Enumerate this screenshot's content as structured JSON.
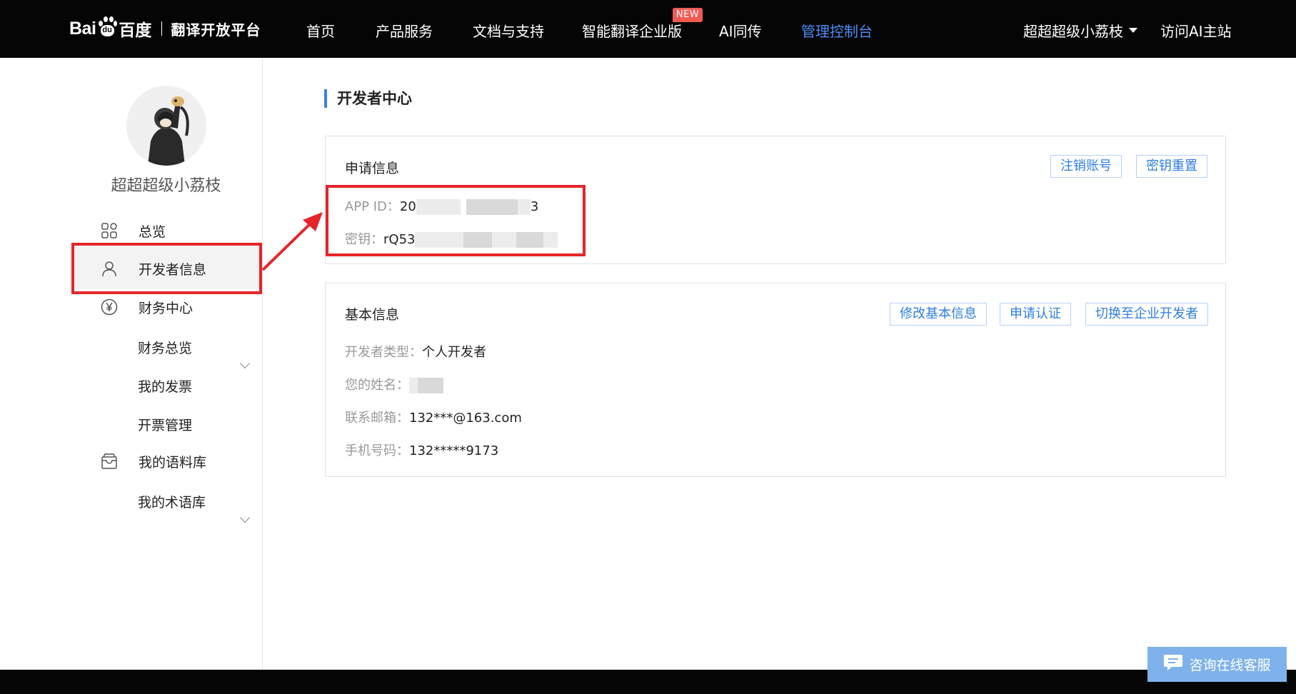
{
  "brand": {
    "logo_latin": "Bai",
    "logo_paw": "du",
    "logo_cn": "百度",
    "platform": "翻译开放平台"
  },
  "nav": {
    "items": [
      {
        "label": "首页"
      },
      {
        "label": "产品服务"
      },
      {
        "label": "文档与支持"
      },
      {
        "label": "智能翻译企业版"
      },
      {
        "label": "AI同传"
      },
      {
        "label": "管理控制台"
      }
    ],
    "new_badge": "NEW",
    "user": "超超超级小荔枝",
    "visit": "访问AI主站",
    "active_color": "#4b8df8"
  },
  "sidebar": {
    "user_name": "超超超级小荔枝",
    "items": [
      {
        "label": "总览",
        "icon": "grid-icon"
      },
      {
        "label": "开发者信息",
        "icon": "user-icon"
      },
      {
        "label": "财务中心",
        "icon": "yen-icon"
      },
      {
        "label": "财务总览"
      },
      {
        "label": "我的发票"
      },
      {
        "label": "开票管理"
      },
      {
        "label": "我的语料库",
        "icon": "inbox-icon"
      },
      {
        "label": "我的术语库"
      }
    ]
  },
  "main": {
    "title": "开发者中心",
    "apply": {
      "title": "申请信息",
      "app_id_label": "APP ID：",
      "app_id_start": "20",
      "app_id_end": "3",
      "key_label": "密钥：",
      "key_start": "rQ53",
      "buttons": [
        "注销账号",
        "密钥重置"
      ]
    },
    "basic": {
      "title": "基本信息",
      "buttons": [
        "修改基本信息",
        "申请认证",
        "切换至企业开发者"
      ],
      "type_label": "开发者类型：",
      "type_value": "个人开发者",
      "name_label": "您的姓名：",
      "name_value": "",
      "email_label": "联系邮箱：",
      "email_value": "132***@163.com",
      "phone_label": "手机号码：",
      "phone_value": "132*****9173"
    }
  },
  "chat": {
    "label": "咨询在线客服"
  },
  "colors": {
    "accent": "#3d7ef4",
    "annotation": "#e5252b",
    "badge": "#f25b54"
  }
}
